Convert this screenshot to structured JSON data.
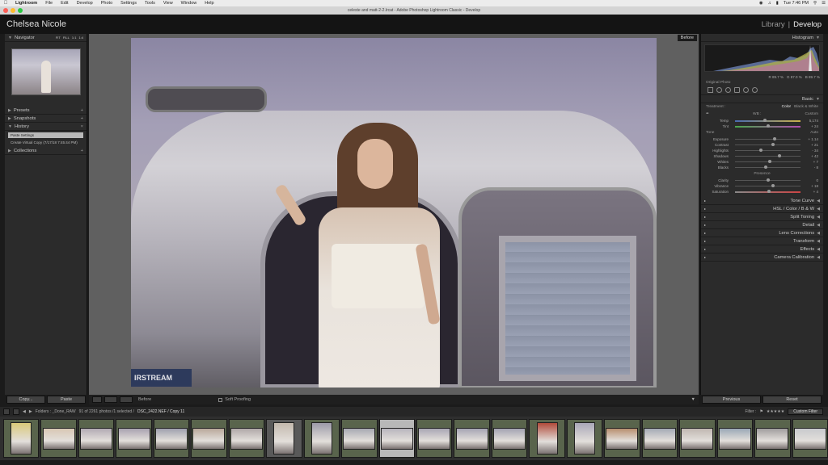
{
  "menubar": {
    "app": "Lightroom",
    "items": [
      "File",
      "Edit",
      "Develop",
      "Photo",
      "Settings",
      "Tools",
      "View",
      "Window",
      "Help"
    ],
    "time": "Tue 7:46 PM"
  },
  "window": {
    "title": "celeste and matt-2-2.lrcat - Adobe Photoshop Lightroom Classic - Develop"
  },
  "identity": {
    "name": "Chelsea Nicole",
    "library": "Library",
    "separator": "|",
    "develop": "Develop"
  },
  "left": {
    "navigator": "Navigator",
    "zoom": [
      "FIT",
      "FILL",
      "1:1",
      "1:4"
    ],
    "presets": "Presets",
    "snapshots": "Snapshots",
    "history": "History",
    "history_items": [
      "Paste Settings",
      "Create Virtual Copy (7/17/18 7:45:44 PM)"
    ],
    "collections": "Collections",
    "copy": "Copy...",
    "paste": "Paste"
  },
  "center": {
    "before": "Before",
    "badge": "IRSTREAM"
  },
  "toolbar": {
    "before": "Before",
    "soft_proofing": "Soft Proofing"
  },
  "right": {
    "histogram": "Histogram",
    "rgb": [
      "R 89.7 %",
      "G 87.0 %",
      "B 89.7 %"
    ],
    "original": "Original Photo",
    "basic": "Basic",
    "treatment": "Treatment :",
    "color": "Color",
    "bw": "Black & White",
    "wb": "WB :",
    "wb_value": "Custom",
    "sliders": [
      {
        "label": "Temp",
        "value": "5,174",
        "pos": 0.46,
        "cls": "grad-temp"
      },
      {
        "label": "Tint",
        "value": "+ 24",
        "pos": 0.5,
        "cls": "grad-tint"
      }
    ],
    "tone": "Tone",
    "auto": "Auto",
    "tone_sliders": [
      {
        "label": "Exposure",
        "value": "+ 1.14",
        "pos": 0.6
      },
      {
        "label": "Contrast",
        "value": "+ 21",
        "pos": 0.58
      },
      {
        "label": "Highlights",
        "value": "- 34",
        "pos": 0.4
      },
      {
        "label": "Shadows",
        "value": "+ 42",
        "pos": 0.68
      },
      {
        "label": "Whites",
        "value": "+ 7",
        "pos": 0.53
      },
      {
        "label": "Blacks",
        "value": "- 8",
        "pos": 0.47
      }
    ],
    "presence": "Presence",
    "presence_sliders": [
      {
        "label": "Clarity",
        "value": "0",
        "pos": 0.5
      },
      {
        "label": "Vibrance",
        "value": "+ 18",
        "pos": 0.58
      },
      {
        "label": "Saturation",
        "value": "+ 4",
        "pos": 0.52,
        "cls": "grad-sat"
      }
    ],
    "sections": [
      "Tone Curve",
      "HSL / Color / B & W",
      "Split Toning",
      "Detail",
      "Lens Corrections",
      "Transform",
      "Effects",
      "Camera Calibration"
    ],
    "previous": "Previous",
    "reset": "Reset"
  },
  "filmstrip": {
    "folder": "Folders : _Done_RAW",
    "count": "91 of 2261 photos /1 selected /",
    "file": "DSC_2422.NEF / Copy 11",
    "filter": "Filter :",
    "custom": "Custom Filter"
  }
}
